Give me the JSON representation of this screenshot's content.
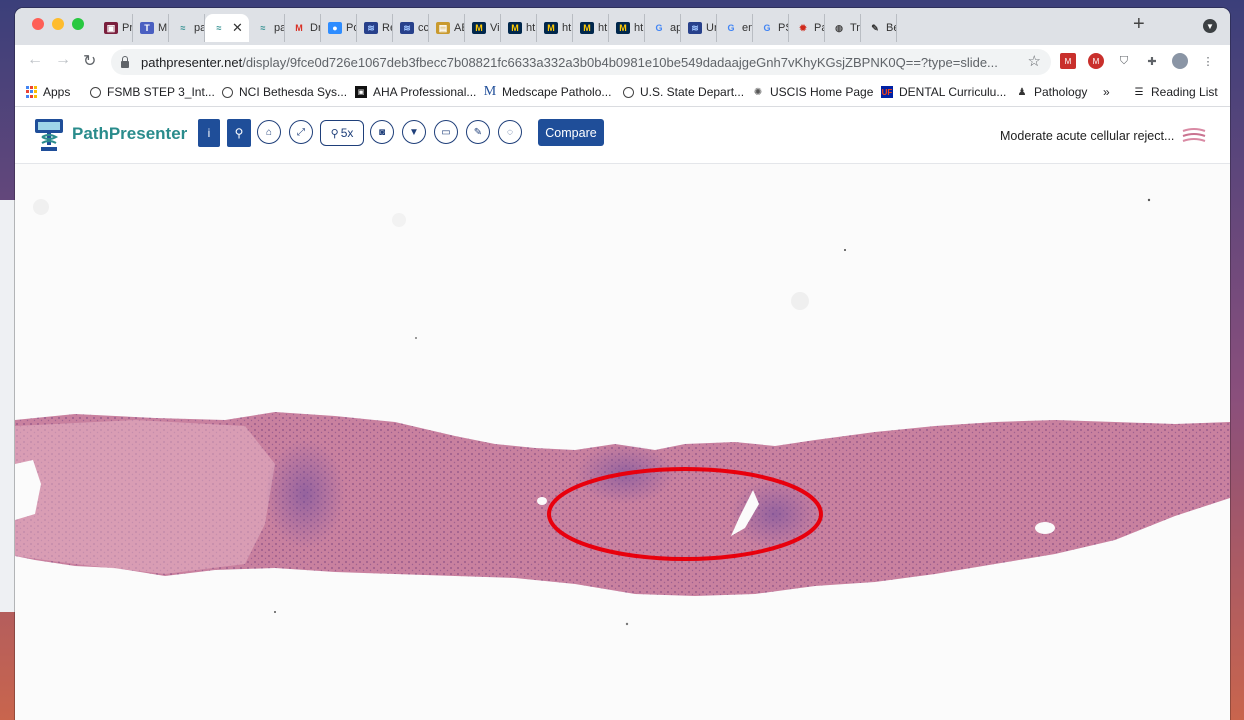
{
  "browser": {
    "tabs": [
      {
        "label": "Pr",
        "icon": "maroon-square-icon"
      },
      {
        "label": "M",
        "icon": "teams-icon"
      },
      {
        "label": "pa",
        "icon": "pathpresenter-icon"
      },
      {
        "label": "",
        "icon": "pathpresenter-icon",
        "active": true
      },
      {
        "label": "pa",
        "icon": "pathpresenter-icon"
      },
      {
        "label": "Dr",
        "icon": "gmail-icon"
      },
      {
        "label": "Po",
        "icon": "zoom-icon"
      },
      {
        "label": "Re",
        "icon": "blue-stripes-icon"
      },
      {
        "label": "cc",
        "icon": "blue-stripes-icon"
      },
      {
        "label": "AE",
        "icon": "doc-icon"
      },
      {
        "label": "Vi",
        "icon": "michigan-icon"
      },
      {
        "label": "ht",
        "icon": "michigan-icon"
      },
      {
        "label": "ht",
        "icon": "michigan-icon"
      },
      {
        "label": "ht",
        "icon": "michigan-icon"
      },
      {
        "label": "ht",
        "icon": "michigan-icon"
      },
      {
        "label": "ap",
        "icon": "google-icon"
      },
      {
        "label": "Ur",
        "icon": "blue-stripes-icon"
      },
      {
        "label": "en",
        "icon": "google-icon"
      },
      {
        "label": "PS",
        "icon": "google-icon"
      },
      {
        "label": "Pa",
        "icon": "red-gear-icon"
      },
      {
        "label": "Tr",
        "icon": "globe-icon"
      },
      {
        "label": "Be",
        "icon": "pen-icon"
      }
    ],
    "active_close": "✕",
    "new_tab": "+",
    "url_host": "pathpresenter.net",
    "url_rest": "/display/9fce0d726e1067deb3fbecc7b08821fc6633a332a3b0b4b0981e10be549dadaajgeGnh7vKhyKGsjZBPNK0Q==?type=slide...",
    "bookmarks": [
      {
        "label": "Apps",
        "icon": "apps-grid-icon"
      },
      {
        "label": "FSMB STEP 3_Int...",
        "icon": "globe-icon"
      },
      {
        "label": "NCI Bethesda Sys...",
        "icon": "globe-icon"
      },
      {
        "label": "AHA Professional...",
        "icon": "aha-icon"
      },
      {
        "label": "Medscape Patholo...",
        "icon": "medscape-icon"
      },
      {
        "label": "U.S. State Depart...",
        "icon": "globe-icon"
      },
      {
        "label": "USCIS Home Page",
        "icon": "uscis-seal-icon"
      },
      {
        "label": "DENTAL Curriculu...",
        "icon": "uf-icon"
      },
      {
        "label": "Pathology",
        "icon": "person-icon"
      }
    ],
    "bookmarks_more": "»",
    "reading_list": "Reading List"
  },
  "app": {
    "brand": "PathPresenter",
    "zoom_label": "5x",
    "compare_label": "Compare",
    "slide_title": "Moderate acute cellular reject..."
  },
  "colors": {
    "brand_teal": "#2a8c8c",
    "button_blue": "#1f4e99",
    "tissue_pink": "#c9819f",
    "annotation_red": "#e8000d"
  }
}
